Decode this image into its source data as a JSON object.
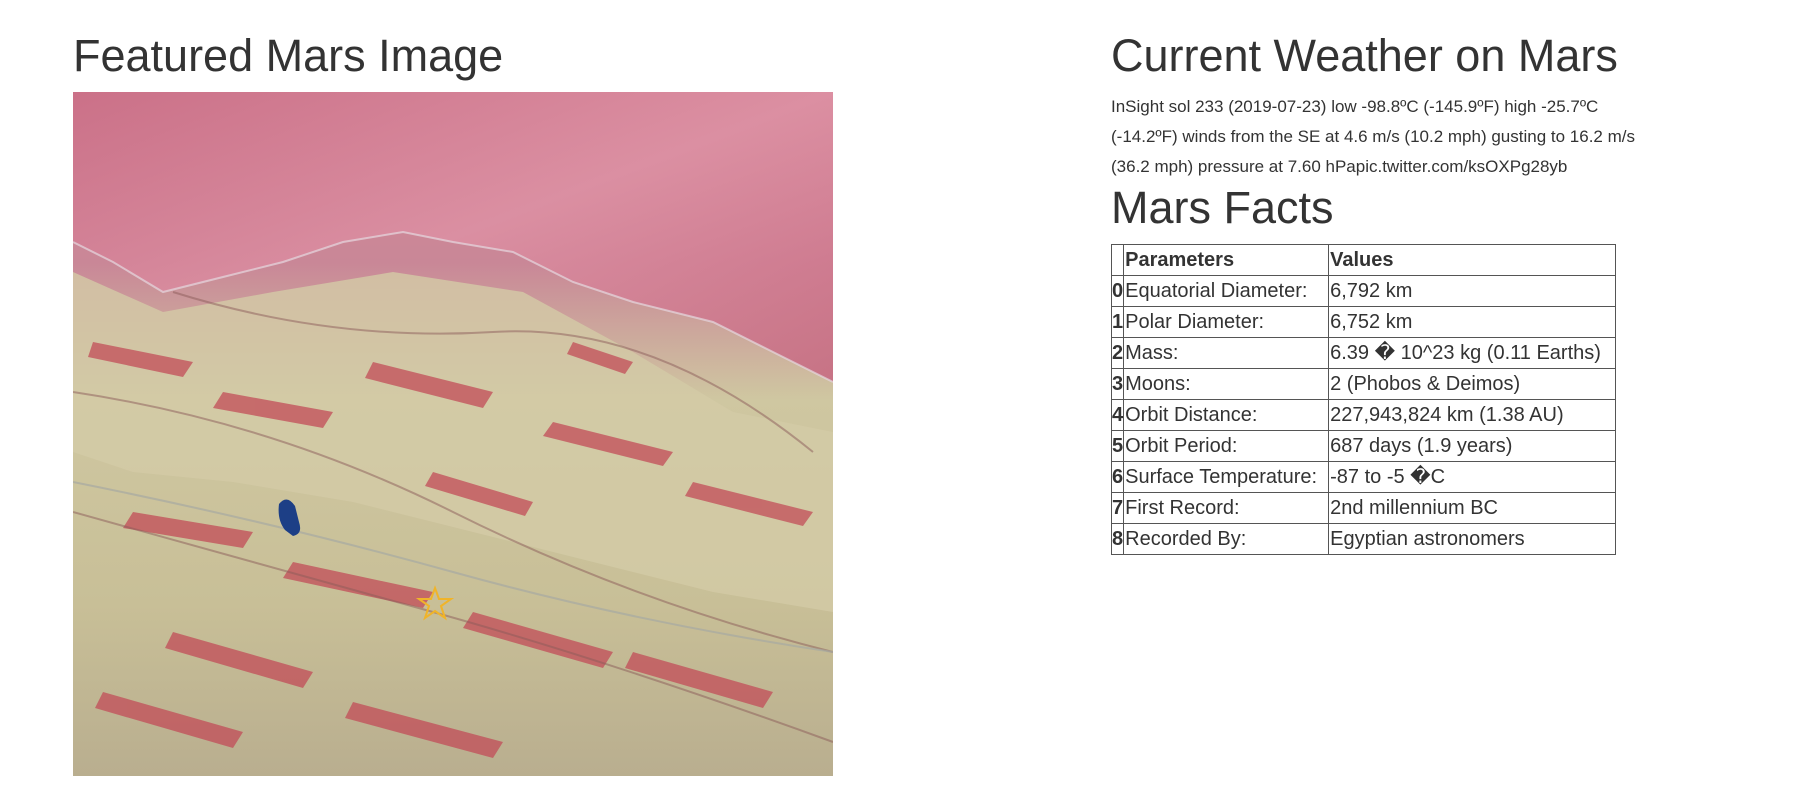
{
  "featured": {
    "title": "Featured Mars Image"
  },
  "weather": {
    "title": "Current Weather on Mars",
    "text": "InSight sol 233 (2019-07-23) low -98.8ºC (-145.9ºF) high -25.7ºC (-14.2ºF) winds from the SE at 4.6 m/s (10.2 mph) gusting to 16.2 m/s (36.2 mph) pressure at 7.60 hPapic.twitter.com/ksOXPg28yb"
  },
  "facts": {
    "title": "Mars Facts",
    "headers": [
      "",
      "Parameters",
      "Values"
    ],
    "rows": [
      {
        "index": "0",
        "param": "Equatorial Diameter:",
        "value": "6,792 km"
      },
      {
        "index": "1",
        "param": "Polar Diameter:",
        "value": "6,752 km"
      },
      {
        "index": "2",
        "param": "Mass:",
        "value": "6.39 � 10^23 kg (0.11 Earths)"
      },
      {
        "index": "3",
        "param": "Moons:",
        "value": "2 (Phobos & Deimos)"
      },
      {
        "index": "4",
        "param": "Orbit Distance:",
        "value": "227,943,824 km (1.38 AU)"
      },
      {
        "index": "5",
        "param": "Orbit Period:",
        "value": "687 days (1.9 years)"
      },
      {
        "index": "6",
        "param": "Surface Temperature:",
        "value": "-87 to -5 �C"
      },
      {
        "index": "7",
        "param": "First Record:",
        "value": "2nd millennium BC"
      },
      {
        "index": "8",
        "param": "Recorded By:",
        "value": "Egyptian astronomers"
      }
    ]
  },
  "colors": {
    "text": "#333333",
    "terrain_pink": "#c9657a",
    "terrain_tan": "#c8c49a",
    "terrain_red": "#c04a52",
    "lake_blue": "#1d3f86",
    "marker_yellow": "#f0b429"
  }
}
